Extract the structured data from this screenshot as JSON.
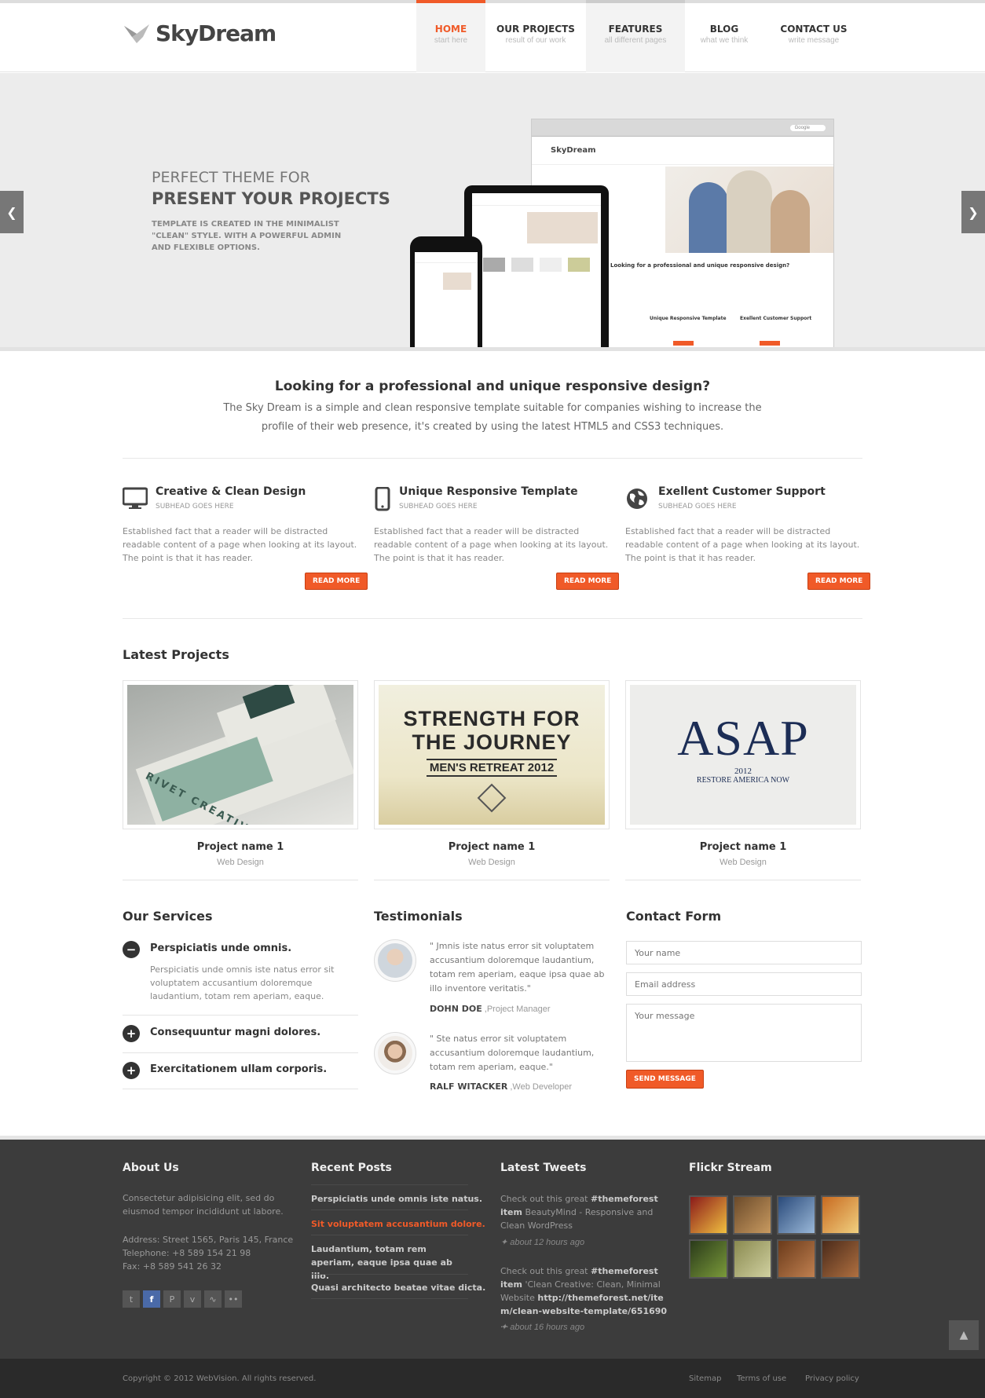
{
  "brand": {
    "name": "SkyDream"
  },
  "nav": [
    {
      "label": "HOME",
      "sub": "start here"
    },
    {
      "label": "OUR PROJECTS",
      "sub": "result of our work"
    },
    {
      "label": "FEATURES",
      "sub": "all different pages"
    },
    {
      "label": "BLOG",
      "sub": "what we think"
    },
    {
      "label": "CONTACT US",
      "sub": "write message"
    }
  ],
  "colors": {
    "accent": "#f05a28",
    "footer": "#3c3c3c",
    "bottom_bar": "#2a2a2a"
  },
  "hero": {
    "subtitle": "PERFECT THEME FOR",
    "title": "PRESENT YOUR PROJECTS",
    "description": "TEMPLATE IS CREATED IN THE MINIMALIST \"CLEAN\" STYLE. WITH A POWERFUL ADMIN AND FLEXIBLE OPTIONS.",
    "prev_icon": "chevron-left-icon",
    "next_icon": "chevron-right-icon",
    "mockup": {
      "brand": "SkyDream",
      "heading": "Looking for a professional and unique responsive design?",
      "feature_1": "Unique Responsive Template",
      "feature_2": "Exellent Customer Support",
      "search_placeholder": "Google"
    }
  },
  "intro": {
    "title": "Looking for a professional and unique responsive design?",
    "text": "The Sky Dream is a simple and clean responsive template suitable for companies wishing to increase the profile of their web presence, it's created by using the latest HTML5 and CSS3 techniques."
  },
  "features": [
    {
      "icon": "monitor-icon",
      "title": "Creative & Clean Design",
      "subhead": "SUBHEAD GOES HERE",
      "text": "Established fact that a reader will be distracted readable content of a page when looking at its layout. The point is that it has reader.",
      "button": "READ MORE"
    },
    {
      "icon": "mobile-phone-icon",
      "title": "Unique Responsive Template",
      "subhead": "SUBHEAD GOES HERE",
      "text": "Established fact that a reader will be distracted readable content of a page when looking at its layout. The point is that it has reader.",
      "button": "READ MORE"
    },
    {
      "icon": "globe-icon",
      "title": "Exellent Customer Support",
      "subhead": "SUBHEAD GOES HERE",
      "text": "Established fact that a reader will be distracted readable content of a page when looking at its layout. The point is that it has reader.",
      "button": "READ MORE"
    }
  ],
  "projects": {
    "title": "Latest Projects",
    "items": [
      {
        "name": "Project name 1",
        "category": "Web Design",
        "image_text": "RIVET CREATIVE GROUP"
      },
      {
        "name": "Project name 1",
        "category": "Web Design",
        "image_text_1": "STRENGTH FOR",
        "image_text_2": "THE JOURNEY",
        "image_text_3": "MEN'S RETREAT 2012"
      },
      {
        "name": "Project name 1",
        "category": "Web Design",
        "image_text_1": "ASAP",
        "image_text_2": "2012",
        "image_text_3": "RESTORE AMERICA NOW"
      }
    ]
  },
  "services": {
    "title": "Our Services",
    "items": [
      {
        "label": "Perspiciatis unde omnis.",
        "state": "open",
        "text": "Perspiciatis unde omnis iste natus error sit voluptatem accusantium doloremque laudantium, totam rem aperiam, eaque."
      },
      {
        "label": "Consequuntur magni dolores.",
        "state": "closed"
      },
      {
        "label": "Exercitationem ullam corporis.",
        "state": "closed"
      }
    ]
  },
  "testimonials": {
    "title": "Testimonials",
    "items": [
      {
        "quote": "\" Jmnis iste natus error sit voluptatem accusantium doloremque laudantium, totam rem aperiam, eaque ipsa quae ab illo inventore veritatis.\"",
        "name": "DOHN DOE",
        "role": " ,Project Manager"
      },
      {
        "quote": "\" Ste natus error sit voluptatem accusantium doloremque laudantium, totam rem aperiam, eaque.\"",
        "name": "RALF WITACKER",
        "role": " ,Web Developer"
      }
    ]
  },
  "contact": {
    "title": "Contact Form",
    "name_placeholder": "Your name",
    "email_placeholder": "Email address",
    "message_placeholder": "Your message",
    "button": "SEND MESSAGE"
  },
  "footer": {
    "about": {
      "title": "About Us",
      "text": "Consectetur adipisicing elit, sed do eiusmod tempor incididunt ut labore.",
      "address": "Address: Street 1565, Paris 145, France",
      "telephone": "Telephone: +8 589 154 21 98",
      "fax": "Fax: +8 589 541 26 32",
      "social": [
        "twitter-icon",
        "facebook-icon",
        "pinterest-icon",
        "vimeo-icon",
        "rss-icon",
        "flickr-icon"
      ]
    },
    "posts": {
      "title": "Recent Posts",
      "items": [
        "Perspiciatis unde omnis iste natus.",
        "Sit voluptatem accusantium dolore.",
        "Laudantium, totam rem aperiam, eaque ipsa quae ab illo.",
        "Quasi architecto beatae vitae dicta."
      ]
    },
    "tweets": {
      "title": "Latest Tweets",
      "items": [
        {
          "pre": "Check out this great ",
          "tag": "#themeforest item",
          "body": " BeautyMind - Responsive and Clean WordPress",
          "time": "about 12 hours ago"
        },
        {
          "pre": "Check out this great ",
          "tag": "#themeforest item",
          "body": " 'Clean Creative: Clean, Minimal Website ",
          "link": "http://themeforest.net/item/clean-website-template/651690",
          "tail": " ...",
          "time": "about 16 hours ago"
        }
      ]
    },
    "flickr": {
      "title": "Flickr Stream"
    }
  },
  "bottom": {
    "copyright": "Copyright © 2012 WebVision. All rights reserved.",
    "links": [
      "Sitemap",
      "Terms of use",
      "Privacy policy"
    ]
  }
}
